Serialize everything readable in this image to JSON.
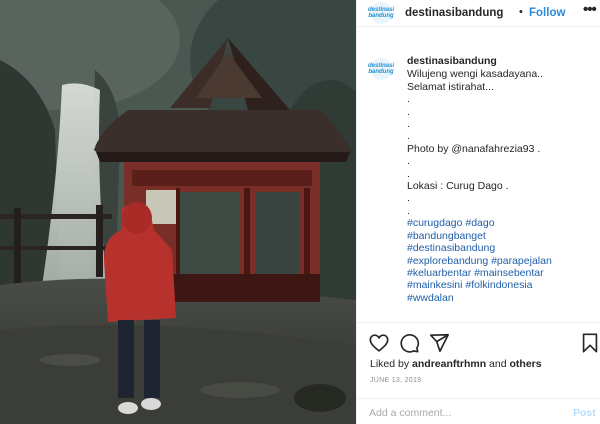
{
  "post": {
    "username": "destinasibandung",
    "separator": "•",
    "follow_label": "Follow",
    "more_label": "•••",
    "avatar_text": "destinasi bandung",
    "caption_lines": [
      "Wilujeng wengi kasadayana..",
      "Selamat istirahat...",
      ".",
      ".",
      ".",
      ".",
      "Photo by @nanafahrezia93 .",
      ".",
      ".",
      "Lokasi : Curug Dago .",
      ".",
      ".",
      "#curugdago #dago",
      "#bandungbanget",
      "#destinasibandung",
      "#explorebandung #parapejalan",
      "#keluarbentar #mainsebentar",
      "#mainkesini #folkindonesia",
      "#wwdalan"
    ],
    "liked_prefix": "Liked by",
    "liked_user": "andreanftrhmn",
    "liked_suffix": "and",
    "liked_others": "others",
    "date": "JUNE 13, 2019",
    "comment_placeholder": "Add a comment...",
    "post_label": "Post"
  },
  "icons": {
    "like": "heart-icon",
    "comment": "comment-icon",
    "share": "paper-plane-icon",
    "save": "bookmark-icon"
  },
  "colors": {
    "link": "#2c8ad8",
    "hashtag": "#1f5fa8",
    "muted": "#8e8e8e",
    "raincoat": "#b8322d"
  }
}
